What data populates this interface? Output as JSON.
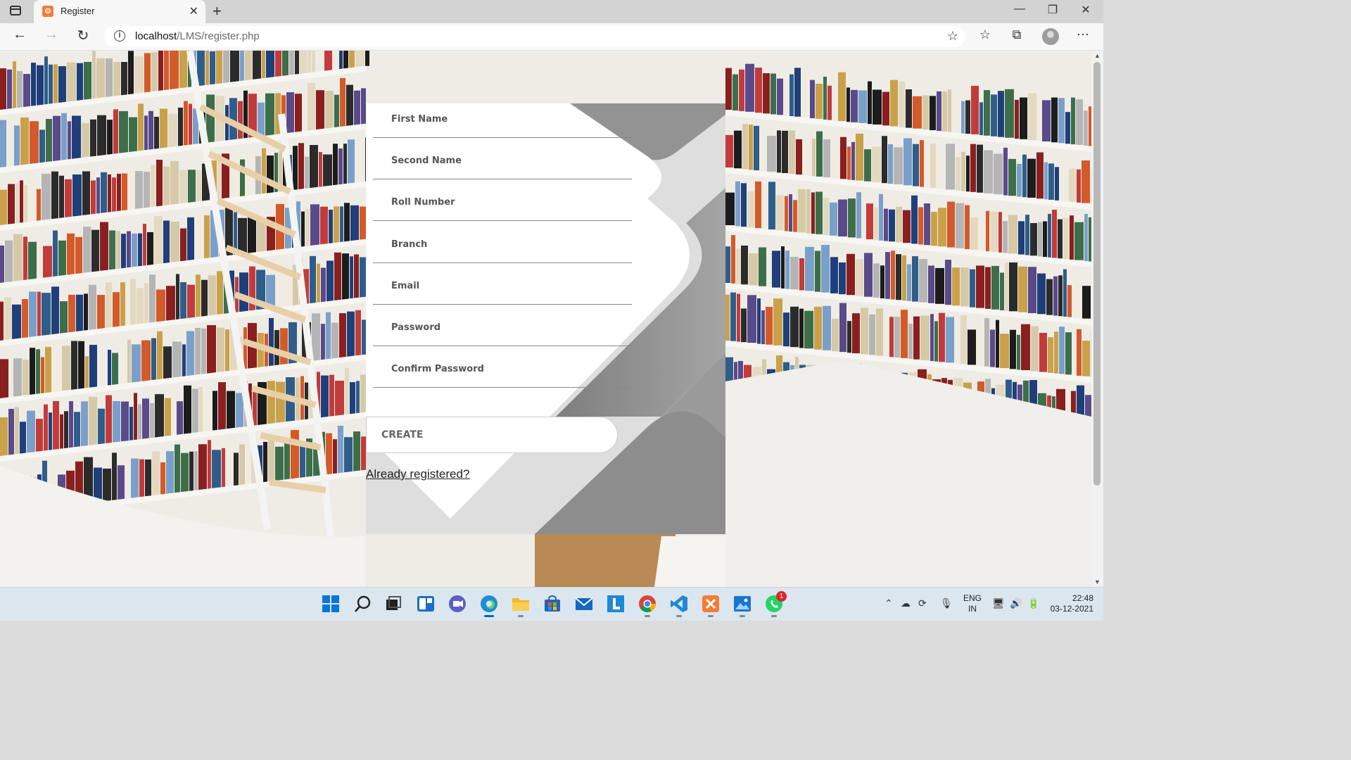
{
  "browser": {
    "tab_title": "Register",
    "url_host": "localhost",
    "url_path": "/LMS/register.php"
  },
  "form": {
    "fields": [
      {
        "name": "first-name-input",
        "placeholder": "First Name"
      },
      {
        "name": "second-name-input",
        "placeholder": "Second Name"
      },
      {
        "name": "roll-number-input",
        "placeholder": "Roll Number"
      },
      {
        "name": "branch-input",
        "placeholder": "Branch"
      },
      {
        "name": "email-input",
        "placeholder": "Email"
      },
      {
        "name": "password-input",
        "placeholder": "Password"
      },
      {
        "name": "confirm-password-input",
        "placeholder": "Confirm Password"
      }
    ],
    "create_label": "CREATE",
    "login_link": "Already registered?"
  },
  "taskbar": {
    "language_top": "ENG",
    "language_bottom": "IN",
    "time": "22:48",
    "date": "03-12-2021",
    "whatsapp_badge": "1"
  },
  "colors": {
    "card_light": "#dedede",
    "card_dark": "#8f8f8f",
    "accent_blue": "#0067c0"
  }
}
